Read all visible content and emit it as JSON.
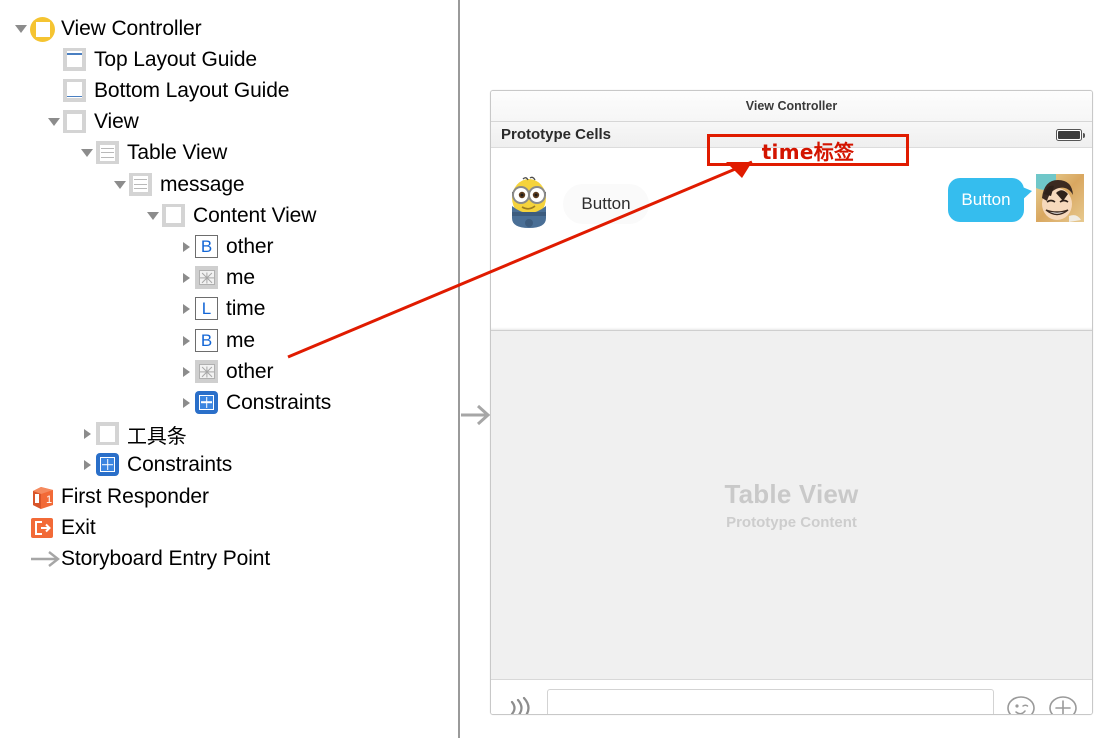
{
  "outline": {
    "name": "document-outline",
    "rows": [
      {
        "label": "View Controller",
        "icon": "view-controller-icon",
        "indent": 0,
        "disclosure": "open",
        "iconType": "vc"
      },
      {
        "label": "Top Layout Guide",
        "icon": "top-layout-guide-icon",
        "indent": 1,
        "disclosure": "none",
        "iconType": "guide-top"
      },
      {
        "label": "Bottom Layout Guide",
        "icon": "bottom-layout-guide-icon",
        "indent": 1,
        "disclosure": "none",
        "iconType": "guide-bot"
      },
      {
        "label": "View",
        "icon": "view-icon",
        "indent": 1,
        "disclosure": "open",
        "iconType": "box"
      },
      {
        "label": "Table View",
        "icon": "table-view-icon",
        "indent": 2,
        "disclosure": "open",
        "iconType": "table"
      },
      {
        "label": "message",
        "icon": "table-view-cell-icon",
        "indent": 3,
        "disclosure": "open",
        "iconType": "table"
      },
      {
        "label": "Content View",
        "icon": "content-view-icon",
        "indent": 4,
        "disclosure": "open",
        "iconType": "box"
      },
      {
        "label": "other",
        "icon": "button-icon",
        "indent": 5,
        "disclosure": "closed",
        "iconType": "letter",
        "glyph": "B"
      },
      {
        "label": "me",
        "icon": "image-view-icon",
        "indent": 5,
        "disclosure": "closed",
        "iconType": "image"
      },
      {
        "label": "time",
        "icon": "label-icon",
        "indent": 5,
        "disclosure": "closed",
        "iconType": "letter",
        "glyph": "L"
      },
      {
        "label": "me",
        "icon": "button-icon",
        "indent": 5,
        "disclosure": "closed",
        "iconType": "letter",
        "glyph": "B"
      },
      {
        "label": "other",
        "icon": "image-view-icon",
        "indent": 5,
        "disclosure": "closed",
        "iconType": "image"
      },
      {
        "label": "Constraints",
        "icon": "constraints-icon",
        "indent": 5,
        "disclosure": "closed",
        "iconType": "constraint"
      },
      {
        "label": "工具条",
        "icon": "toolbar-view-icon",
        "indent": 2,
        "disclosure": "closed",
        "iconType": "box",
        "cjk": true
      },
      {
        "label": "Constraints",
        "icon": "constraints-icon",
        "indent": 2,
        "disclosure": "closed",
        "iconType": "constraint"
      },
      {
        "label": "First Responder",
        "icon": "first-responder-icon",
        "indent": 0,
        "disclosure": "none",
        "iconType": "first-responder"
      },
      {
        "label": "Exit",
        "icon": "exit-icon",
        "indent": 0,
        "disclosure": "none",
        "iconType": "exit"
      },
      {
        "label": "Storyboard Entry Point",
        "icon": "storyboard-entry-point-icon",
        "indent": 0,
        "disclosure": "none",
        "iconType": "arrow"
      }
    ]
  },
  "scene": {
    "nav_title": "View Controller",
    "prototype_label": "Prototype Cells",
    "battery_icon": "battery-icon",
    "cell": {
      "left_avatar": "minion-avatar",
      "left_bubble_label": "Button",
      "right_bubble_label": "Button",
      "right_avatar": "anime-avatar"
    },
    "placeholder": {
      "title": "Table View",
      "subtitle": "Prototype Content"
    },
    "bottom_bar": {
      "voice_icon": "voice-wave-icon",
      "input_value": "",
      "input_placeholder": "",
      "emoji_icon": "emoji-wink-icon",
      "plus_icon": "plus-circle-icon"
    }
  },
  "annotation": {
    "text": "time标签",
    "box_color": "#e01b00",
    "text_color": "#d31400",
    "arrow_color": "#e01b00"
  },
  "colors": {
    "accent_blue": "#1366d6",
    "bubble_blue": "#35bdee",
    "constraint_blue": "#2a6fc9",
    "vc_yellow": "#f5c431",
    "orange": "#f26a37",
    "placeholder_gray": "#c9c9c9"
  }
}
